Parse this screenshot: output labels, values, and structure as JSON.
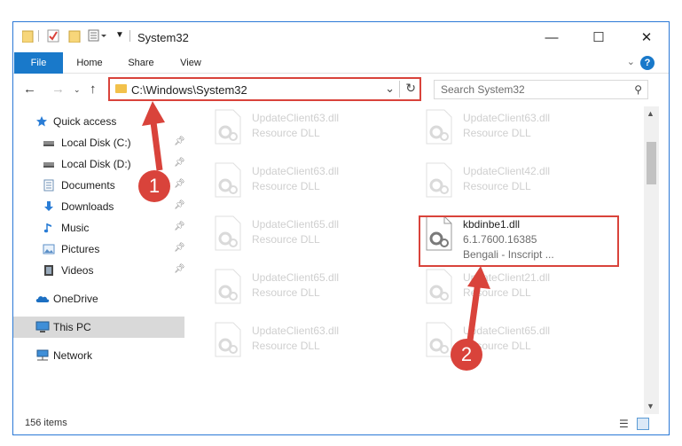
{
  "window": {
    "title": "System32",
    "controls": {
      "minimize": "—",
      "maximize": "☐",
      "close": "✕"
    }
  },
  "ribbon": {
    "tabs": [
      {
        "label": "File"
      },
      {
        "label": "Home"
      },
      {
        "label": "Share"
      },
      {
        "label": "View"
      }
    ],
    "help": "?"
  },
  "navigation": {
    "address": "C:\\Windows\\System32",
    "search_placeholder": "Search System32"
  },
  "sidebar": {
    "items": [
      {
        "label": "Quick access",
        "icon": "star-icon"
      },
      {
        "label": "Local Disk (C:)",
        "icon": "drive-icon",
        "pinned": true
      },
      {
        "label": "Local Disk (D:)",
        "icon": "drive-icon",
        "pinned": true
      },
      {
        "label": "Documents",
        "icon": "documents-icon",
        "pinned": true
      },
      {
        "label": "Downloads",
        "icon": "download-icon",
        "pinned": true
      },
      {
        "label": "Music",
        "icon": "music-icon",
        "pinned": true
      },
      {
        "label": "Pictures",
        "icon": "pictures-icon",
        "pinned": true
      },
      {
        "label": "Videos",
        "icon": "videos-icon",
        "pinned": true
      },
      {
        "label": "OneDrive",
        "icon": "cloud-icon"
      },
      {
        "label": "This PC",
        "icon": "computer-icon",
        "selected": true
      },
      {
        "label": "Network",
        "icon": "network-icon"
      }
    ]
  },
  "files": [
    {
      "name": "UpdateClient63.dll",
      "type": "Resource DLL"
    },
    {
      "name": "UpdateClient63.dll",
      "type": "Resource DLL"
    },
    {
      "name": "UpdateClient63.dll",
      "type": "Resource DLL"
    },
    {
      "name": "UpdateClient42.dll",
      "type": "Resource DLL"
    },
    {
      "name": "UpdateClient65.dll",
      "type": "Resource DLL"
    },
    {
      "name": "kbdinbe1.dll",
      "type": "6.1.7600.16385",
      "desc": "Bengali - Inscript ..."
    },
    {
      "name": "UpdateClient65.dll",
      "type": "Resource DLL"
    },
    {
      "name": "UpdateClient21.dll",
      "type": "Resource DLL"
    },
    {
      "name": "UpdateClient63.dll",
      "type": "Resource DLL"
    },
    {
      "name": "UpdateClient65.dll",
      "type": "Resource DLL"
    }
  ],
  "status": {
    "items": "156 items"
  },
  "callouts": {
    "one": "1",
    "two": "2"
  },
  "colors": {
    "accent": "#1979ca",
    "highlight": "#d9433b",
    "folder": "#f2c14b"
  }
}
